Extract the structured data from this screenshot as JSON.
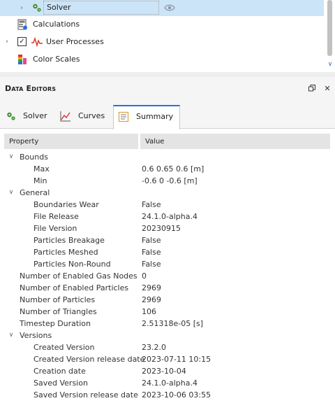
{
  "tree": {
    "items": [
      {
        "label": "Solver",
        "icon": "gears-icon",
        "selected": true,
        "expandable": true
      },
      {
        "label": "Calculations",
        "icon": "calculator-icon",
        "selected": false,
        "expandable": false
      },
      {
        "label": "User Processes",
        "icon": "pulse-icon",
        "selected": false,
        "expandable": true,
        "checked": true
      },
      {
        "label": "Color Scales",
        "icon": "color-scale-icon",
        "selected": false,
        "expandable": false
      }
    ]
  },
  "data_editors": {
    "title": "Data Editors",
    "tabs": [
      {
        "label": "Solver",
        "icon": "gears-icon"
      },
      {
        "label": "Curves",
        "icon": "line-chart-icon"
      },
      {
        "label": "Summary",
        "icon": "document-icon",
        "active": true
      }
    ]
  },
  "grid": {
    "columns": [
      "Property",
      "Value"
    ],
    "rows": [
      {
        "name": "Bounds",
        "value": "",
        "level": 0,
        "group": true
      },
      {
        "name": "Max",
        "value": "0.6 0.65 0.6 [m]",
        "level": 1
      },
      {
        "name": "Min",
        "value": "-0.6 0 -0.6 [m]",
        "level": 1
      },
      {
        "name": "General",
        "value": "",
        "level": 0,
        "group": true
      },
      {
        "name": "Boundaries Wear",
        "value": "False",
        "level": 1
      },
      {
        "name": "File Release",
        "value": "24.1.0-alpha.4",
        "level": 1
      },
      {
        "name": "File Version",
        "value": "20230915",
        "level": 1
      },
      {
        "name": "Particles Breakage",
        "value": "False",
        "level": 1
      },
      {
        "name": "Particles Meshed",
        "value": "False",
        "level": 1
      },
      {
        "name": "Particles Non-Round",
        "value": "False",
        "level": 1
      },
      {
        "name": "Number of Enabled Gas Nodes",
        "value": "0",
        "level": 0
      },
      {
        "name": "Number of Enabled Particles",
        "value": "2969",
        "level": 0
      },
      {
        "name": "Number of Particles",
        "value": "2969",
        "level": 0
      },
      {
        "name": "Number of Triangles",
        "value": "106",
        "level": 0
      },
      {
        "name": "Timestep Duration",
        "value": "2.51318e-05 [s]",
        "level": 0
      },
      {
        "name": "Versions",
        "value": "",
        "level": 0,
        "group": true
      },
      {
        "name": "Created Version",
        "value": "23.2.0",
        "level": 1
      },
      {
        "name": "Created Version release date",
        "value": "2023-07-11 10:15",
        "level": 1
      },
      {
        "name": "Creation date",
        "value": "2023-10-04",
        "level": 1
      },
      {
        "name": "Saved Version",
        "value": "24.1.0-alpha.4",
        "level": 1
      },
      {
        "name": "Saved Version release date",
        "value": "2023-10-06 03:55",
        "level": 1
      }
    ]
  },
  "colors": {
    "selection": "#cce4f7",
    "accent": "#2a6fd6",
    "header_bg": "#e4e4e4"
  }
}
